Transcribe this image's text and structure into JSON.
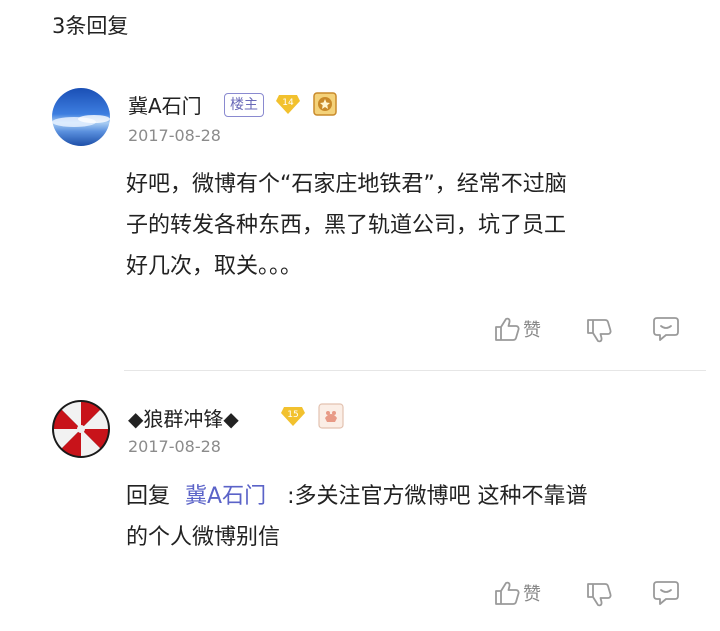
{
  "header": {
    "reply_count": "3条回复"
  },
  "comments": [
    {
      "username": "冀A石门",
      "owner_tag": "楼主",
      "level": "14",
      "date": "2017-08-28",
      "lines": [
        "好吧，微博有个“石家庄地铁君”，经常不过脑",
        "子的转发各种东西，黑了轨道公司，坑了员工",
        "好几次，取关。。。"
      ],
      "like_label": "赞"
    },
    {
      "username": "◆狼群冲锋◆",
      "level": "15",
      "date": "2017-08-28",
      "reply_prefix": "回复",
      "reply_target": "冀A石门",
      "line1_rest": ":多关注官方微博吧 这种不靠谱",
      "line2": "的个人微博别信",
      "like_label": "赞"
    }
  ],
  "colors": {
    "mention": "#5b63c8",
    "level_badge": "#f2c12e",
    "owner_tag": "#6a6ab8"
  }
}
